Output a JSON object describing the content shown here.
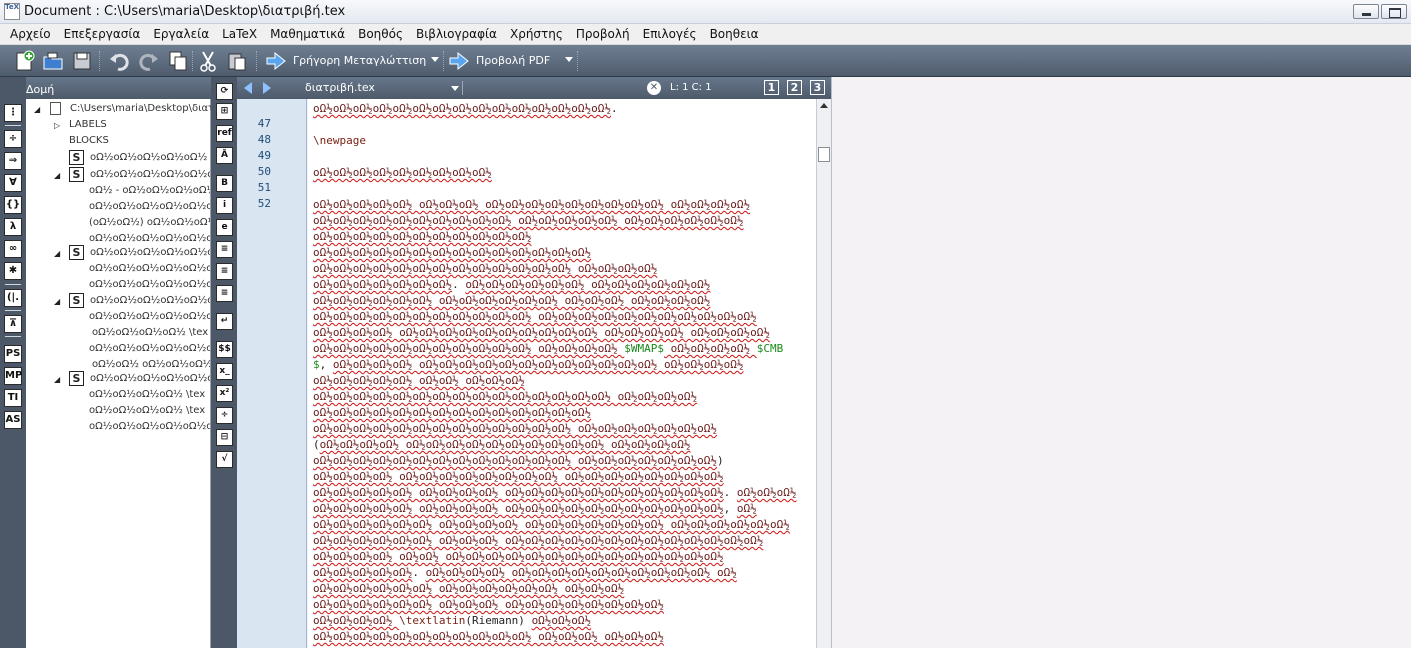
{
  "window": {
    "title": "Document : C:\\Users\\maria\\Desktop\\διατριβή.tex",
    "icon_label": "TeX"
  },
  "menu": [
    "Αρχείο",
    "Επεξεργασία",
    "Εργαλεία",
    "LaTeX",
    "Μαθηματικά",
    "Βοηθός",
    "Βιβλιογραφία",
    "Χρήστης",
    "Προβολή",
    "Επιλογές",
    "Βοηθεια"
  ],
  "toolbar": {
    "quick_build_label": "Γρήγορη Μεταγλώττιση",
    "view_pdf_label": "Προβολή PDF"
  },
  "structure": {
    "header_label": "Δομή",
    "root_path": "C:\\Users\\maria\\Desktop\\διατ",
    "labels_node": "LABELS",
    "blocks_node": "BLOCKS",
    "section_icon_letter": "S",
    "rows": [
      "οΩ½οΩ½οΩ½οΩ½οΩ½",
      "οΩ½οΩ½οΩ½οΩ½οΩ½οΩ½",
      "οΩ½ - οΩ½οΩ½οΩ½οΩ½",
      "οΩ½οΩ½οΩ½οΩ½οΩ½οΩ½",
      "(οΩ½οΩ½) οΩ½οΩ½οΩ½",
      "οΩ½οΩ½οΩ½οΩ½οΩ½οΩ½",
      "οΩ½οΩ½οΩ½οΩ½οΩ½οΩ½",
      "οΩ½οΩ½οΩ½οΩ½οΩ½οΩ½",
      "οΩ½οΩ½οΩ½οΩ½οΩ½οΩ½",
      "οΩ½οΩ½οΩ½οΩ½οΩ½οΩ½",
      "οΩ½οΩ½οΩ½οΩ½οΩ½οΩ½",
      "οΩ½οΩ½οΩ½οΩ½ \\tex",
      "οΩ½οΩ½οΩ½οΩ½οΩ½οΩ½",
      "οΩ½οΩ½ οΩ½οΩ½οΩ½οΩ½",
      "οΩ½οΩ½οΩ½οΩ½οΩ½οΩ½",
      "οΩ½οΩ½οΩ½οΩ½ \\tex",
      "οΩ½οΩ½οΩ½οΩ½ \\tex",
      "οΩ½οΩ½οΩ½οΩ½οΩ½οΩ½"
    ]
  },
  "leftbar_icons": [
    "⋮",
    "÷",
    "⇒",
    "∀",
    "{}",
    "λ",
    "∞",
    "✱",
    "(|.",
    "⊼",
    "PS",
    "MP",
    "TI",
    "AS"
  ],
  "mathbar_icons": [
    "⊞",
    "ref",
    "Ă",
    "B",
    "i",
    "e",
    "≡",
    "≡",
    "≡",
    "↵",
    "$$",
    "x_",
    "x²",
    "÷",
    "⊟",
    "√"
  ],
  "editor": {
    "file_tab": "διατριβή.tex",
    "close_symbol": "✕",
    "cursor_position": "L: 1 C: 1",
    "view_buttons": [
      "1",
      "2",
      "3"
    ],
    "line_numbers": [
      "47",
      "48",
      "49",
      "50",
      "51",
      "52"
    ],
    "lines": [
      [
        {
          "t": "οΩ½οΩ½οΩ½οΩ½οΩ½οΩ½οΩ½οΩ½οΩ½οΩ½οΩ½οΩ½οΩ½οΩ½οΩ½",
          "k": "m"
        },
        {
          "t": ".",
          "k": "n"
        }
      ],
      [],
      [
        {
          "t": "\\newpage",
          "k": "c"
        }
      ],
      [],
      [
        {
          "t": "οΩ½οΩ½οΩ½οΩ½οΩ½οΩ½οΩ½οΩ½οΩ½",
          "k": "m"
        }
      ],
      [],
      [
        {
          "t": "οΩ½οΩ½οΩ½οΩ½οΩ½ οΩ½οΩ½οΩ½ οΩ½οΩ½οΩ½οΩ½οΩ½οΩ½οΩ½οΩ½οΩ½ οΩ½οΩ½οΩ½οΩ½",
          "k": "m"
        }
      ],
      [
        {
          "t": "οΩ½οΩ½οΩ½οΩ½οΩ½οΩ½οΩ½οΩ½οΩ½οΩ½ οΩ½οΩ½οΩ½οΩ½οΩ½ οΩ½οΩ½οΩ½οΩ½οΩ½οΩ½",
          "k": "m"
        }
      ],
      [
        {
          "t": "οΩ½οΩ½οΩ½οΩ½οΩ½οΩ½οΩ½οΩ½οΩ½οΩ½οΩ½",
          "k": "m"
        }
      ],
      [
        {
          "t": "οΩ½οΩ½οΩ½οΩ½οΩ½οΩ½οΩ½οΩ½οΩ½οΩ½οΩ½οΩ½οΩ½οΩ½",
          "k": "m"
        }
      ],
      [
        {
          "t": "οΩ½οΩ½οΩ½οΩ½οΩ½οΩ½οΩ½οΩ½οΩ½οΩ½οΩ½οΩ½οΩ½ οΩ½οΩ½οΩ½οΩ½",
          "k": "m"
        }
      ],
      [
        {
          "t": "οΩ½οΩ½οΩ½οΩ½οΩ½οΩ½οΩ½",
          "k": "m"
        },
        {
          "t": ". ",
          "k": "n"
        },
        {
          "t": "οΩ½οΩ½οΩ½οΩ½οΩ½οΩ½ οΩ½οΩ½οΩ½οΩ½οΩ½οΩ½",
          "k": "m"
        }
      ],
      [
        {
          "t": "οΩ½οΩ½οΩ½οΩ½οΩ½οΩ½ οΩ½οΩ½οΩ½οΩ½οΩ½οΩ½ οΩ½οΩ½οΩ½ οΩ½οΩ½οΩ½οΩ½",
          "k": "m"
        }
      ],
      [
        {
          "t": "οΩ½οΩ½οΩ½οΩ½οΩ½οΩ½οΩ½οΩ½οΩ½οΩ½οΩ½ οΩ½οΩ½οΩ½οΩ½οΩ½οΩ½οΩ½οΩ½οΩ½οΩ½οΩ½",
          "k": "m"
        }
      ],
      [
        {
          "t": "οΩ½οΩ½οΩ½οΩ½ οΩ½οΩ½οΩ½οΩ½οΩ½οΩ½οΩ½οΩ½οΩ½οΩ½ οΩ½οΩ½οΩ½οΩ½ οΩ½οΩ½οΩ½οΩ½",
          "k": "m"
        }
      ],
      [
        {
          "t": "οΩ½οΩ½οΩ½οΩ½οΩ½οΩ½οΩ½οΩ½οΩ½οΩ½οΩ½ οΩ½οΩ½οΩ½οΩ½ ",
          "k": "m"
        },
        {
          "t": "$WMAP$",
          "k": "g"
        },
        {
          "t": " οΩ½οΩ½οΩ½οΩ½ ",
          "k": "m"
        },
        {
          "t": "$CMB",
          "k": "g"
        }
      ],
      [
        {
          "t": "$",
          "k": "g"
        },
        {
          "t": ", ",
          "k": "n"
        },
        {
          "t": "οΩ½οΩ½οΩ½οΩ½ οΩ½οΩ½οΩ½οΩ½οΩ½οΩ½οΩ½οΩ½οΩ½οΩ½οΩ½οΩ½ οΩ½οΩ½οΩ½οΩ½",
          "k": "m"
        }
      ],
      [
        {
          "t": "οΩ½οΩ½οΩ½οΩ½οΩ½ οΩ½οΩ½ οΩ½οΩ½οΩ½",
          "k": "m"
        }
      ],
      [
        {
          "t": "οΩ½οΩ½οΩ½οΩ½οΩ½οΩ½οΩ½οΩ½οΩ½οΩ½οΩ½οΩ½οΩ½οΩ½οΩ½ οΩ½οΩ½οΩ½οΩ½",
          "k": "m"
        }
      ],
      [
        {
          "t": "οΩ½οΩ½οΩ½οΩ½οΩ½οΩ½οΩ½οΩ½οΩ½οΩ½οΩ½οΩ½οΩ½οΩ½",
          "k": "m"
        }
      ],
      [
        {
          "t": "οΩ½οΩ½οΩ½οΩ½οΩ½οΩ½οΩ½οΩ½οΩ½οΩ½οΩ½οΩ½οΩ½ οΩ½οΩ½οΩ½οΩ½οΩ½οΩ½οΩ½",
          "k": "m"
        }
      ],
      [
        {
          "t": "(",
          "k": "n"
        },
        {
          "t": "οΩ½οΩ½οΩ½οΩ½ οΩ½οΩ½οΩ½οΩ½οΩ½οΩ½οΩ½οΩ½οΩ½οΩ½ οΩ½οΩ½οΩ½οΩ½",
          "k": "m"
        }
      ],
      [
        {
          "t": "οΩ½οΩ½οΩ½οΩ½οΩ½οΩ½οΩ½οΩ½οΩ½οΩ½οΩ½οΩ½οΩ½ οΩ½οΩ½οΩ½οΩ½οΩ½οΩ½οΩ½",
          "k": "m"
        },
        {
          "t": ")",
          "k": "n"
        }
      ],
      [
        {
          "t": "οΩ½οΩ½οΩ½οΩ½ οΩ½οΩ½οΩ½οΩ½οΩ½οΩ½οΩ½οΩ½ οΩ½οΩ½οΩ½οΩ½οΩ½οΩ½οΩ½οΩ½",
          "k": "m"
        }
      ],
      [
        {
          "t": "οΩ½οΩ½οΩ½οΩ½οΩ½ οΩ½οΩ½οΩ½οΩ½ οΩ½οΩ½οΩ½οΩ½οΩ½οΩ½οΩ½οΩ½οΩ½οΩ½οΩ½",
          "k": "m"
        },
        {
          "t": ". ",
          "k": "n"
        },
        {
          "t": "οΩ½οΩ½οΩ½",
          "k": "m"
        }
      ],
      [
        {
          "t": "οΩ½οΩ½οΩ½οΩ½οΩ½ οΩ½οΩ½οΩ½οΩ½ οΩ½οΩ½οΩ½οΩ½οΩ½οΩ½οΩ½οΩ½οΩ½οΩ½οΩ½",
          "k": "m"
        },
        {
          "t": ", ",
          "k": "n"
        },
        {
          "t": "οΩ½",
          "k": "m"
        }
      ],
      [
        {
          "t": "οΩ½οΩ½οΩ½οΩ½οΩ½οΩ½ οΩ½οΩ½οΩ½οΩ½ οΩ½οΩ½οΩ½οΩ½οΩ½οΩ½οΩ½ οΩ½οΩ½οΩ½οΩ½οΩ½οΩ½",
          "k": "m"
        }
      ],
      [
        {
          "t": "οΩ½οΩ½οΩ½οΩ½οΩ½οΩ½ οΩ½οΩ½οΩ½ οΩ½οΩ½οΩ½οΩ½οΩ½οΩ½οΩ½οΩ½οΩ½οΩ½οΩ½οΩ½οΩ½",
          "k": "m"
        }
      ],
      [
        {
          "t": "οΩ½οΩ½οΩ½οΩ½ οΩ½οΩ½ οΩ½οΩ½οΩ½οΩ½οΩ½οΩ½οΩ½οΩ½οΩ½οΩ½οΩ½οΩ½οΩ½οΩ½",
          "k": "m"
        }
      ],
      [
        {
          "t": "οΩ½οΩ½οΩ½οΩ½οΩ½",
          "k": "m"
        },
        {
          "t": ". ",
          "k": "n"
        },
        {
          "t": "οΩ½οΩ½οΩ½οΩ½ οΩ½οΩ½οΩ½οΩ½οΩ½οΩ½οΩ½οΩ½οΩ½οΩ½ οΩ½",
          "k": "m"
        }
      ],
      [
        {
          "t": "οΩ½οΩ½οΩ½οΩ½οΩ½οΩ½ οΩ½οΩ½οΩ½οΩ½οΩ½οΩ½ οΩ½οΩ½οΩ½",
          "k": "m"
        }
      ],
      [
        {
          "t": "οΩ½οΩ½οΩ½οΩ½οΩ½οΩ½ οΩ½οΩ½οΩ½ οΩ½οΩ½οΩ½οΩ½οΩ½οΩ½οΩ½οΩ½",
          "k": "m"
        }
      ],
      [
        {
          "t": "οΩ½οΩ½οΩ½οΩ½ ",
          "k": "m"
        },
        {
          "t": "\\textlatin",
          "k": "c"
        },
        {
          "t": "(Riemann) ",
          "k": "n"
        },
        {
          "t": "οΩ½οΩ½οΩ½",
          "k": "m"
        }
      ],
      [
        {
          "t": "οΩ½οΩ½οΩ½οΩ½οΩ½οΩ½οΩ½οΩ½οΩ½οΩ½οΩ½ οΩ½οΩ½οΩ½ οΩ½οΩ½οΩ½",
          "k": "m"
        }
      ]
    ]
  },
  "colors": {
    "toolbar": "#5b6a7c",
    "gutter": "#d9e5f1",
    "misspelled_underline": "#d01010",
    "latex_command": "#7a1f12",
    "math_inline": "#1a8a1a"
  }
}
